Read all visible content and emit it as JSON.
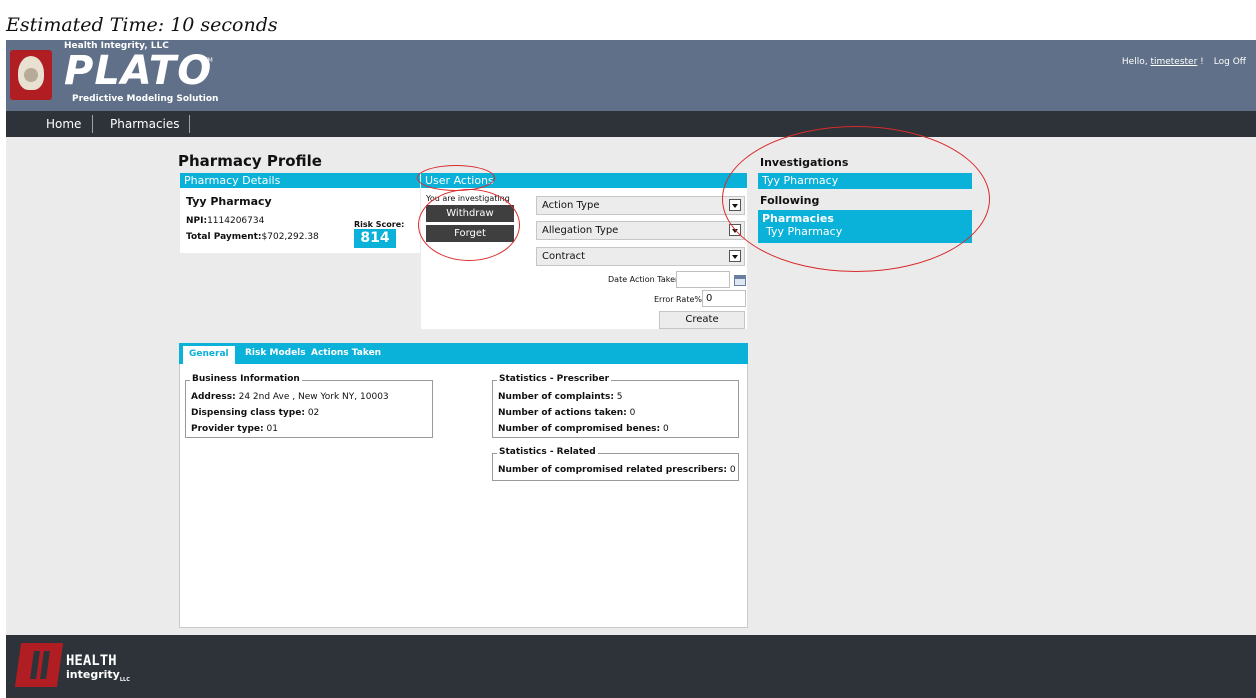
{
  "caption": "Estimated Time: 10 seconds",
  "header": {
    "org": "Health Integrity, LLC",
    "product": "PLATO",
    "tm": "TM",
    "tagline": "Predictive Modeling Solution",
    "greeting_prefix": "Hello, ",
    "username": "timetester",
    "greeting_suffix": " !",
    "logoff": "Log Off"
  },
  "nav": {
    "items": [
      "Home",
      "Pharmacies"
    ]
  },
  "page_title": "Pharmacy Profile",
  "pharmacy_details": {
    "header": "Pharmacy Details",
    "name": "Tyy Pharmacy",
    "npi_label": "NPI:",
    "npi": "1114206734",
    "total_payment_label": "Total Payment:",
    "total_payment": "$702,292.38",
    "risk_score_label": "Risk Score:",
    "risk_score": "814"
  },
  "user_actions": {
    "header": "User Actions",
    "investigating_text": "You are investigating",
    "withdraw": "Withdraw",
    "forget": "Forget",
    "action_type": "Action Type",
    "allegation_type": "Allegation Type",
    "contract": "Contract",
    "date_label": "Date Action Taken:",
    "error_rate_label": "Error Rate%:",
    "error_rate": "0",
    "create": "Create"
  },
  "sidebar": {
    "investigations": "Investigations",
    "investigations_item": "Tyy Pharmacy",
    "following": "Following",
    "pharmacies": "Pharmacies",
    "pharmacies_item": "Tyy Pharmacy"
  },
  "tabs": [
    "General",
    "Risk Models",
    "Actions Taken"
  ],
  "business_info": {
    "legend": "Business Information",
    "address_label": "Address:",
    "address": "24 2nd Ave , New York NY, 10003",
    "dispensing_label": "Dispensing class type:",
    "dispensing": "02",
    "provider_label": "Provider type:",
    "provider": "01"
  },
  "stats_prescriber": {
    "legend": "Statistics - Prescriber",
    "complaints_label": "Number of complaints:",
    "complaints": "5",
    "actions_label": "Number of actions taken:",
    "actions": "0",
    "benes_label": "Number of compromised benes:",
    "benes": "0"
  },
  "stats_related": {
    "legend": "Statistics - Related",
    "related_label": "Number of compromised related prescribers:",
    "related": "0"
  },
  "footer": {
    "brand_line1": "HEALTH",
    "brand_line2": "integrity",
    "brand_sub": "LLC"
  },
  "colors": {
    "accent": "#0ab1d9",
    "header": "#5f7088",
    "nav": "#2d3339",
    "annotation": "#d92b2b"
  }
}
